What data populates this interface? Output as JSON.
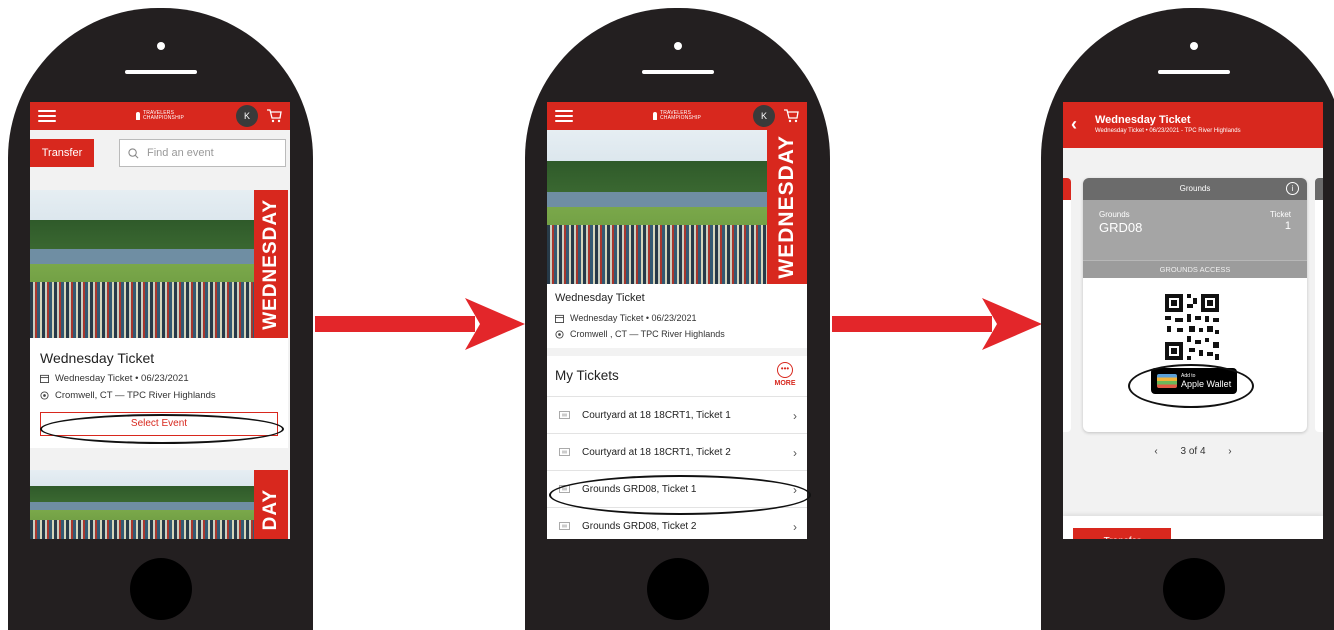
{
  "brand": {
    "logo_text": "TRAVELERS CHAMPIONSHIP",
    "avatar_initial": "K",
    "accent": "#d8281e"
  },
  "screen1": {
    "transfer_label": "Transfer",
    "search_placeholder": "Find an event",
    "banner_text": "WEDNESDAY",
    "banner_text_partial": "DAY",
    "event_title": "Wednesday Ticket",
    "event_date_line": "Wednesday Ticket • 06/23/2021",
    "event_location": "Cromwell, CT — TPC River Highlands",
    "select_label": "Select Event"
  },
  "screen2": {
    "banner_text": "WEDNESDAY",
    "event_title": "Wednesday Ticket",
    "event_date_line": "Wednesday Ticket • 06/23/2021",
    "event_location": "Cromwell , CT — TPC River Highlands",
    "my_tickets_heading": "My Tickets",
    "more_label": "MORE",
    "tickets": [
      {
        "label": "Courtyard at 18 18CRT1, Ticket 1"
      },
      {
        "label": "Courtyard at 18 18CRT1, Ticket 2"
      },
      {
        "label": "Grounds GRD08, Ticket 1"
      },
      {
        "label": "Grounds GRD08, Ticket 2"
      }
    ]
  },
  "screen3": {
    "title": "Wednesday Ticket",
    "subtitle": "Wednesday Ticket • 06/23/2021 - TPC River Highlands",
    "ticket_header": "Grounds",
    "section_label": "Grounds",
    "section_value": "GRD08",
    "ticket_label": "Ticket",
    "ticket_value": "1",
    "access_label": "GROUNDS ACCESS",
    "wallet_small": "Add to",
    "wallet_large": "Apple Wallet",
    "pager_text": "3 of 4",
    "bottom_button": "Transfer"
  }
}
